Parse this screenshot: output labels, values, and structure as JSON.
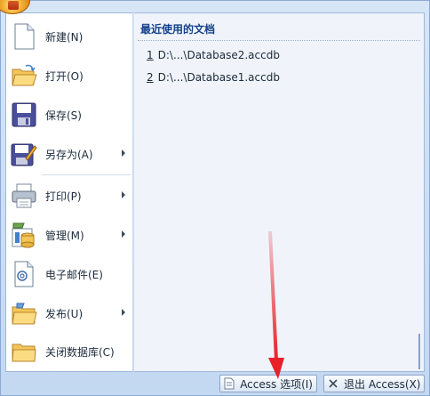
{
  "menu": {
    "items": [
      {
        "label": "新建(N)",
        "has_submenu": false,
        "icon": "new-document-icon"
      },
      {
        "label": "打开(O)",
        "has_submenu": false,
        "icon": "open-folder-icon"
      },
      {
        "label": "保存(S)",
        "has_submenu": false,
        "icon": "save-disk-icon"
      },
      {
        "label": "另存为(A)",
        "has_submenu": true,
        "icon": "save-as-icon"
      },
      {
        "label": "打印(P)",
        "has_submenu": true,
        "icon": "printer-icon"
      },
      {
        "label": "管理(M)",
        "has_submenu": true,
        "icon": "manage-database-icon"
      },
      {
        "label": "电子邮件(E)",
        "has_submenu": false,
        "icon": "email-document-icon"
      },
      {
        "label": "发布(U)",
        "has_submenu": true,
        "icon": "publish-folder-icon"
      },
      {
        "label": "关闭数据库(C)",
        "has_submenu": false,
        "icon": "close-database-folder-icon"
      }
    ]
  },
  "recent": {
    "title": "最近使用的文档",
    "items": [
      {
        "num": "1",
        "path": "D:\\...\\Database2.accdb"
      },
      {
        "num": "2",
        "path": "D:\\...\\Database1.accdb"
      }
    ]
  },
  "buttons": {
    "options_label": "Access 选项(I)",
    "exit_label": "退出 Access(X)"
  },
  "colors": {
    "annotation_arrow": "#e8202a",
    "title_text": "#15428b"
  }
}
